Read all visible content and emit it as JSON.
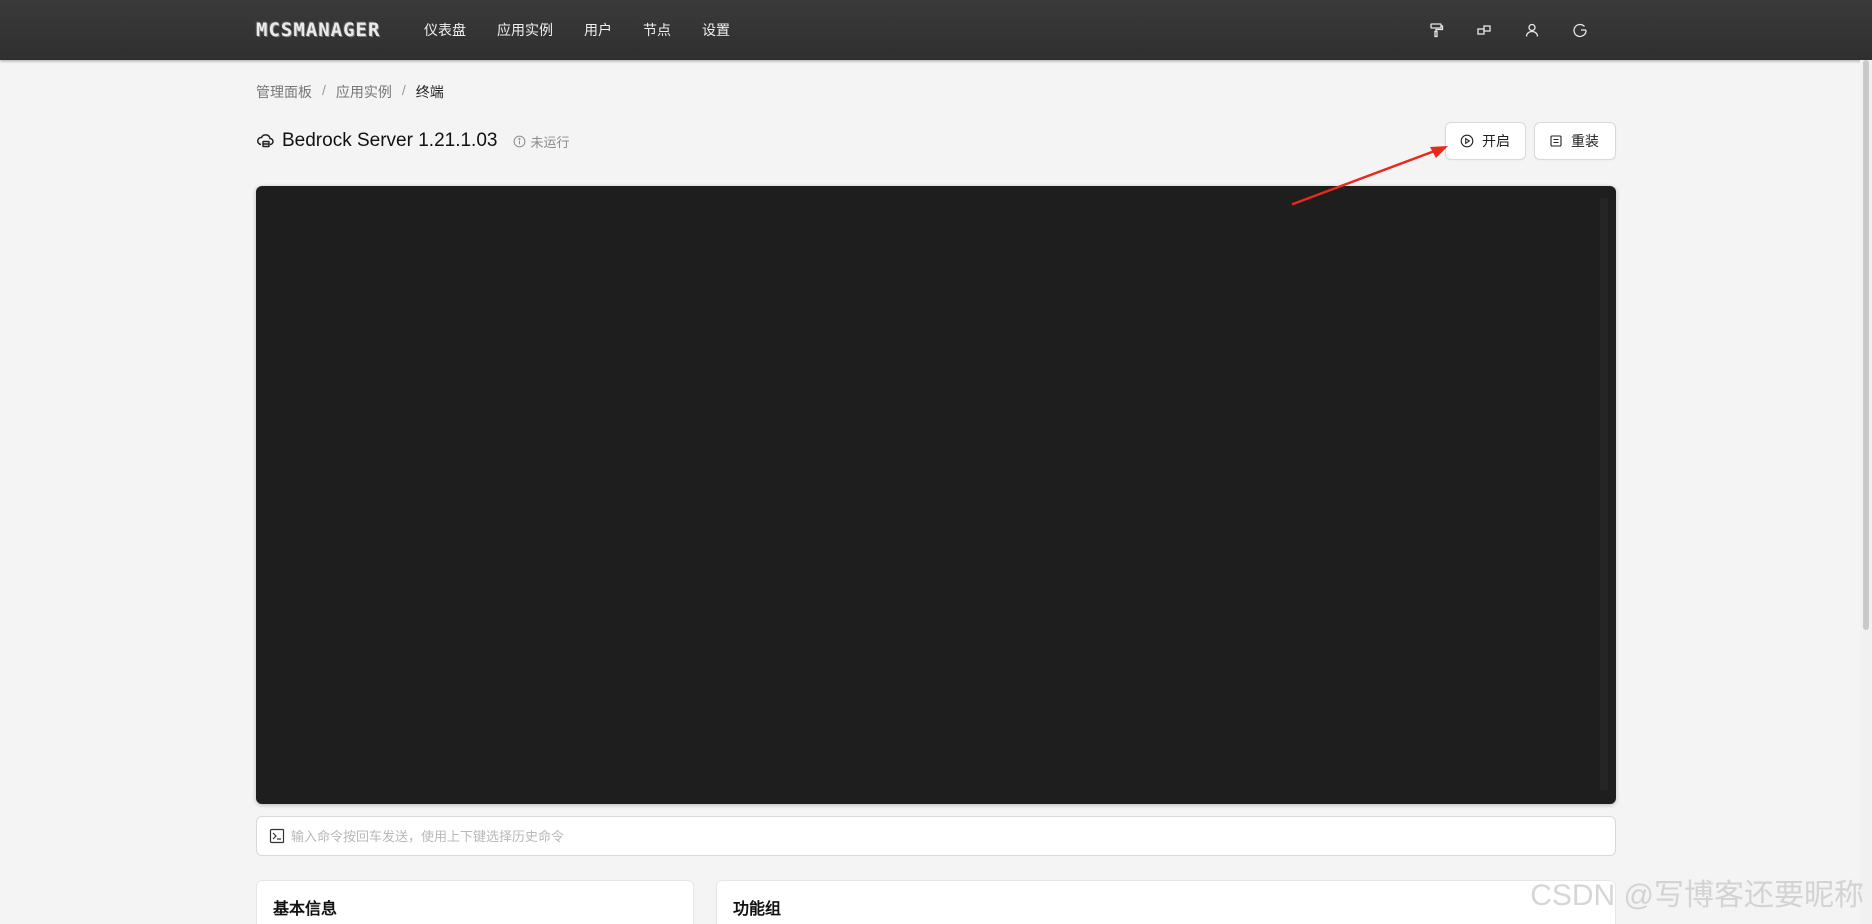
{
  "app": {
    "logo_text": "MCSMANAGER"
  },
  "nav": {
    "items": [
      {
        "label": "仪表盘"
      },
      {
        "label": "应用实例"
      },
      {
        "label": "用户"
      },
      {
        "label": "节点"
      },
      {
        "label": "设置"
      }
    ]
  },
  "top_icons": [
    "brush-icon",
    "layout-icon",
    "user-icon",
    "logout-icon"
  ],
  "breadcrumb": {
    "items": [
      "管理面板",
      "应用实例",
      "终端"
    ],
    "separator": "/"
  },
  "instance": {
    "title": "Bedrock Server 1.21.1.03",
    "status": "未运行"
  },
  "buttons": {
    "start_label": "开启",
    "reinstall_label": "重装"
  },
  "command": {
    "placeholder": "输入命令按回车发送，使用上下键选择历史命令",
    "value": ""
  },
  "cards": {
    "basic_info_title": "基本信息",
    "function_group_title": "功能组"
  },
  "watermark": "CSDN @写博客还要昵称",
  "colors": {
    "topbar": "#333333",
    "terminal_bg": "#1e1e1e",
    "page_bg": "#f4f4f4",
    "annotation_arrow": "#e8291c"
  }
}
